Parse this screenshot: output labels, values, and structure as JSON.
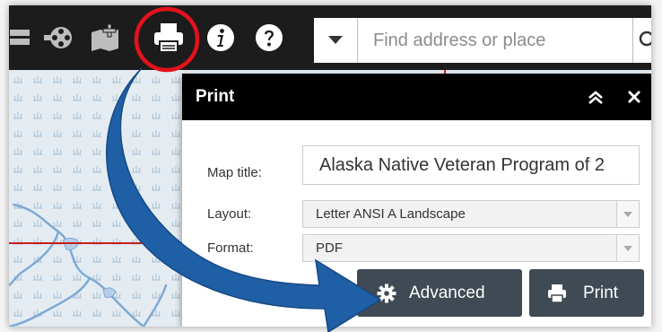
{
  "toolbar": {
    "icons": [
      "layers-icon",
      "basemap-gallery-icon",
      "add-data-icon",
      "print-icon",
      "info-icon",
      "help-icon"
    ]
  },
  "search": {
    "placeholder": "Find address or place",
    "value": ""
  },
  "print_panel": {
    "title": "Print",
    "map_title_label": "Map title:",
    "map_title_value": "Alaska Native Veteran Program of 2",
    "layout_label": "Layout:",
    "layout_value": "Letter ANSI A Landscape",
    "format_label": "Format:",
    "format_value": "PDF",
    "advanced_label": "Advanced",
    "print_label": "Print"
  },
  "colors": {
    "toolbar_bg": "#1c1c1c",
    "panel_header_bg": "#000000",
    "button_bg": "#3f4a54",
    "highlight_circle": "#e3121b",
    "arrow": "#1f5fa6",
    "map_boundary": "#c81e1e",
    "river": "#7fa9d6"
  }
}
